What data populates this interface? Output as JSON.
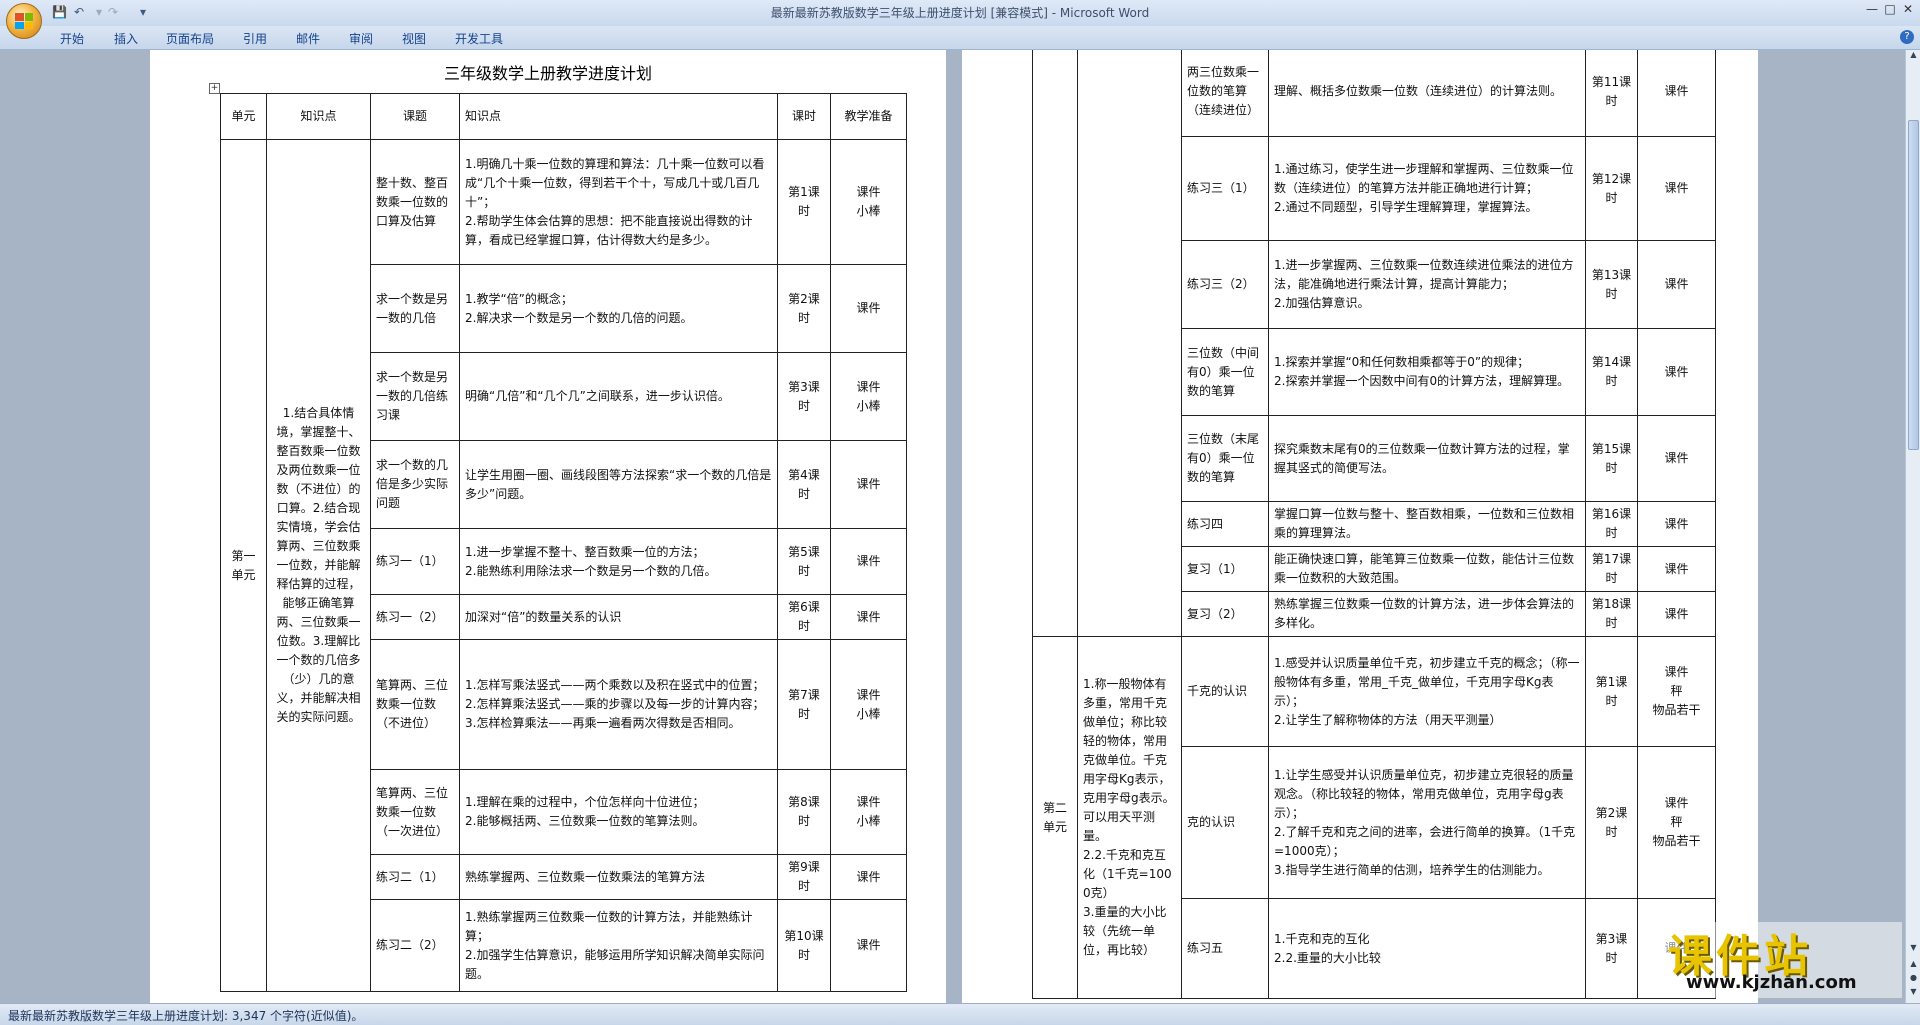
{
  "window": {
    "title": "最新最新苏教版数学三年级上册进度计划 [兼容模式] - Microsoft Word"
  },
  "quick_access": {
    "save_icon": "save-icon",
    "undo_icon": "undo-icon",
    "redo_icon": "redo-icon",
    "customize_icon": "customize-icon"
  },
  "ribbon_tabs": [
    {
      "label": "开始"
    },
    {
      "label": "插入"
    },
    {
      "label": "页面布局"
    },
    {
      "label": "引用"
    },
    {
      "label": "邮件"
    },
    {
      "label": "审阅"
    },
    {
      "label": "视图"
    },
    {
      "label": "开发工具"
    }
  ],
  "document": {
    "title": "三年级数学上册教学进度计划",
    "headers": [
      "单元",
      "知识点",
      "课题",
      "知识点",
      "课时",
      "教学准备"
    ],
    "unit1": {
      "name": "第一单元",
      "knowledge": "1.结合具体情境，掌握整十、整百数乘一位数及两位数乘一位数（不进位）的口算。2.结合现实情境，学会估算两、三位数乘一位数，并能解释估算的过程，能够正确笔算两、三位数乘一位数。3.理解比一个数的几倍多（少）几的意义，并能解决相关的实际问题。",
      "rows": [
        {
          "topic": "整十数、整百数乘一位数的口算及估算",
          "detail": "1.明确几十乘一位数的算理和算法：几十乘一位数可以看成“几个十乘一位数，得到若干个十，写成几十或几百几十”；\n2.帮助学生体会估算的思想：把不能直接说出得数的计算，看成已经掌握口算，估计得数大约是多少。",
          "period": "第1课时",
          "prep": "课件\n小棒"
        },
        {
          "topic": "求一个数是另一数的几倍",
          "detail": "1.教学“倍”的概念；\n2.解决求一个数是另一个数的几倍的问题。",
          "period": "第2课时",
          "prep": "课件"
        },
        {
          "topic": "求一个数是另一数的几倍练习课",
          "detail": "明确“几倍”和“几个几”之间联系，进一步认识倍。",
          "period": "第3课时",
          "prep": "课件\n小棒"
        },
        {
          "topic": "求一个数的几倍是多少实际问题",
          "detail": "让学生用圈一圈、画线段图等方法探索“求一个数的几倍是多少”问题。",
          "period": "第4课时",
          "prep": "课件"
        },
        {
          "topic": "练习一（1）",
          "detail": "1.进一步掌握不整十、整百数乘一位的方法；\n2.能熟练利用除法求一个数是另一个数的几倍。",
          "period": "第5课时",
          "prep": "课件"
        },
        {
          "topic": "练习一（2）",
          "detail": "加深对“倍”的数量关系的认识",
          "period": "第6课时",
          "prep": "课件"
        },
        {
          "topic": "笔算两、三位数乘一位数（不进位）",
          "detail": "1.怎样写乘法竖式——两个乘数以及积在竖式中的位置；\n2.怎样算乘法竖式——乘的步骤以及每一步的计算内容；\n3.怎样检算乘法——再乘一遍看两次得数是否相同。",
          "period": "第7课时",
          "prep": "课件\n小棒"
        },
        {
          "topic": "笔算两、三位数乘一位数（一次进位）",
          "detail": "1.理解在乘的过程中，个位怎样向十位进位；\n2.能够概括两、三位数乘一位数的笔算法则。",
          "period": "第8课时",
          "prep": "课件\n小棒"
        },
        {
          "topic": "练习二（1）",
          "detail": "熟练掌握两、三位数乘一位数乘法的笔算方法",
          "period": "第9课时",
          "prep": "课件"
        },
        {
          "topic": "练习二（2）",
          "detail": "1.熟练掌握两三位数乘一位数的计算方法，并能熟练计算；\n2.加强学生估算意识，能够运用所学知识解决简单实际问题。",
          "period": "第10课时",
          "prep": "课件"
        }
      ]
    },
    "unit1_cont": [
      {
        "topic": "两三位数乘一位数的笔算（连续进位）",
        "detail": "理解、概括多位数乘一位数（连续进位）的计算法则。",
        "period": "第11课时",
        "prep": "课件"
      },
      {
        "topic": "练习三（1）",
        "detail": "1.通过练习，使学生进一步理解和掌握两、三位数乘一位数（连续进位）的笔算方法并能正确地进行计算；\n2.通过不同题型，引导学生理解算理，掌握算法。",
        "period": "第12课时",
        "prep": "课件"
      },
      {
        "topic": "练习三（2）",
        "detail": "1.进一步掌握两、三位数乘一位数连续进位乘法的进位方法，能准确地进行乘法计算，提高计算能力；\n2.加强估算意识。",
        "period": "第13课时",
        "prep": "课件"
      },
      {
        "topic": "三位数（中间有0）乘一位数的笔算",
        "detail": "1.探索并掌握“0和任何数相乘都等于0”的规律；\n2.探索并掌握一个因数中间有0的计算方法，理解算理。",
        "period": "第14课时",
        "prep": "课件"
      },
      {
        "topic": "三位数（末尾有0）乘一位数的笔算",
        "detail": "探究乘数末尾有0的三位数乘一位数计算方法的过程，掌握其竖式的简便写法。",
        "period": "第15课时",
        "prep": "课件"
      },
      {
        "topic": "练习四",
        "detail": "掌握口算一位数与整十、整百数相乘，一位数和三位数相乘的算理算法。",
        "period": "第16课时",
        "prep": "课件"
      },
      {
        "topic": "复习（1）",
        "detail": "能正确快速口算，能笔算三位数乘一位数，能估计三位数乘一位数积的大致范围。",
        "period": "第17课时",
        "prep": "课件"
      },
      {
        "topic": "复习（2）",
        "detail": "熟练掌握三位数乘一位数的计算方法，进一步体会算法的多样化。",
        "period": "第18课时",
        "prep": "课件"
      }
    ],
    "unit2": {
      "name": "第二单元",
      "knowledge": "1.称一般物体有多重，常用千克做单位；称比较轻的物体，常用克做单位。千克用字母Kg表示，克用字母g表示。可以用天平测量。\n2.2.千克和克互化（1千克=1000克）\n3.重量的大小比较（先统一单位，再比较）",
      "rows": [
        {
          "topic": "千克的认识",
          "detail": "1.感受并认识质量单位千克，初步建立千克的概念；（称一般物体有多重，常用_千克_做单位，千克用字母Kg表示）；\n2.让学生了解称物体的方法（用天平测量）",
          "period": "第1课时",
          "prep": "课件\n秤\n物品若干"
        },
        {
          "topic": "克的认识",
          "detail": "1.让学生感受并认识质量单位克，初步建立克很轻的质量观念。（称比较轻的物体，常用克做单位，克用字母g表示）；\n2.了解千克和克之间的进率，会进行简单的换算。（1千克=1000克）；\n3.指导学生进行简单的估测，培养学生的估测能力。",
          "period": "第2课时",
          "prep": "课件\n秤\n物品若干"
        },
        {
          "topic": "练习五",
          "detail": "1.千克和克的互化\n2.2.重量的大小比较",
          "period": "第3课时",
          "prep": "课件"
        }
      ]
    }
  },
  "statusbar": {
    "text": "最新最新苏教版数学三年级上册进度计划: 3,347 个字符(近似值)。"
  },
  "watermark": {
    "text": "课件站",
    "url": "www.kjzhan.com"
  }
}
